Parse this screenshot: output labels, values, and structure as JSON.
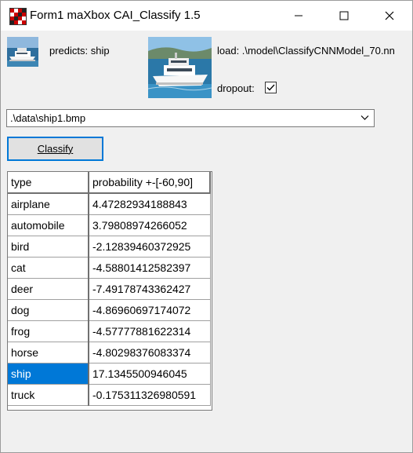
{
  "window": {
    "title": "Form1 maXbox CAI_Classify 1.5"
  },
  "icons": {
    "app": "app-icon-grid",
    "minimize": "minimize-icon",
    "maximize": "maximize-icon",
    "close": "close-icon"
  },
  "prediction": {
    "label": "predicts: ship"
  },
  "model": {
    "label": "load: .\\model\\ClassifyCNNModel_70.nn"
  },
  "dropout": {
    "label": "dropout:",
    "checked": true
  },
  "image_path": {
    "value": ".\\data\\ship1.bmp"
  },
  "classify_button": {
    "label": "Classify"
  },
  "results": {
    "headers": [
      "type",
      "probability +-[-60,90]"
    ],
    "rows": [
      {
        "type": "airplane",
        "probability": "4.47282934188843"
      },
      {
        "type": "automobile",
        "probability": "3.79808974266052"
      },
      {
        "type": "bird",
        "probability": "-2.12839460372925"
      },
      {
        "type": "cat",
        "probability": "-4.58801412582397"
      },
      {
        "type": "deer",
        "probability": "-7.49178743362427"
      },
      {
        "type": "dog",
        "probability": "-4.86960697174072"
      },
      {
        "type": "frog",
        "probability": "-4.57777881622314"
      },
      {
        "type": "horse",
        "probability": "-4.80298376083374"
      },
      {
        "type": "ship",
        "probability": "17.1345500946045",
        "selected": true
      },
      {
        "type": "truck",
        "probability": "-0.175311326980591"
      }
    ]
  },
  "colors": {
    "selection": "#0078d7",
    "focus_border": "#0078d7"
  }
}
